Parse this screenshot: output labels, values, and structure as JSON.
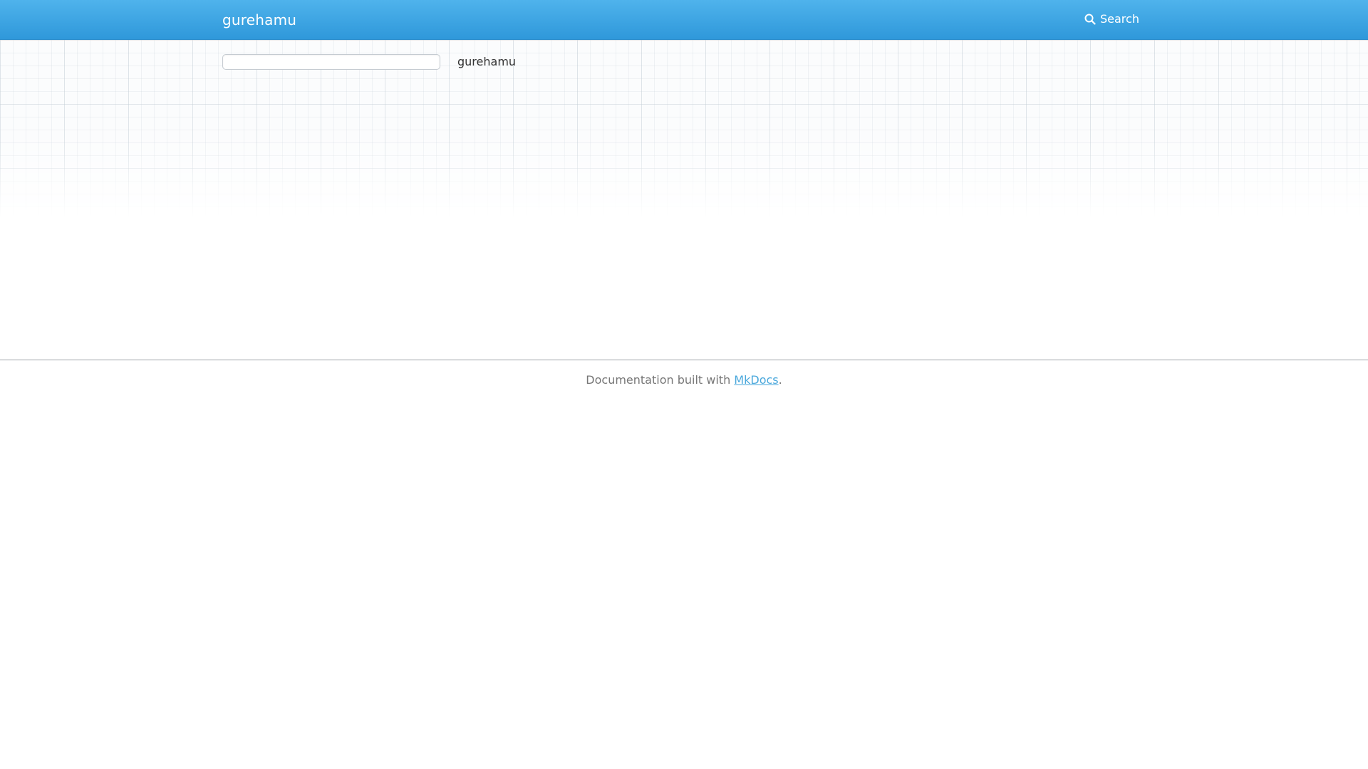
{
  "navbar": {
    "brand": "gurehamu",
    "search_label": "Search",
    "search_icon": "search-icon",
    "accent_color": "#3ba4e4"
  },
  "toc": {
    "filter_value": "",
    "filter_placeholder": "",
    "current_page": "gurehamu"
  },
  "footer": {
    "prefix": "Documentation built with ",
    "link_label": "MkDocs",
    "suffix": ".",
    "link_color": "#4aa8dc"
  }
}
